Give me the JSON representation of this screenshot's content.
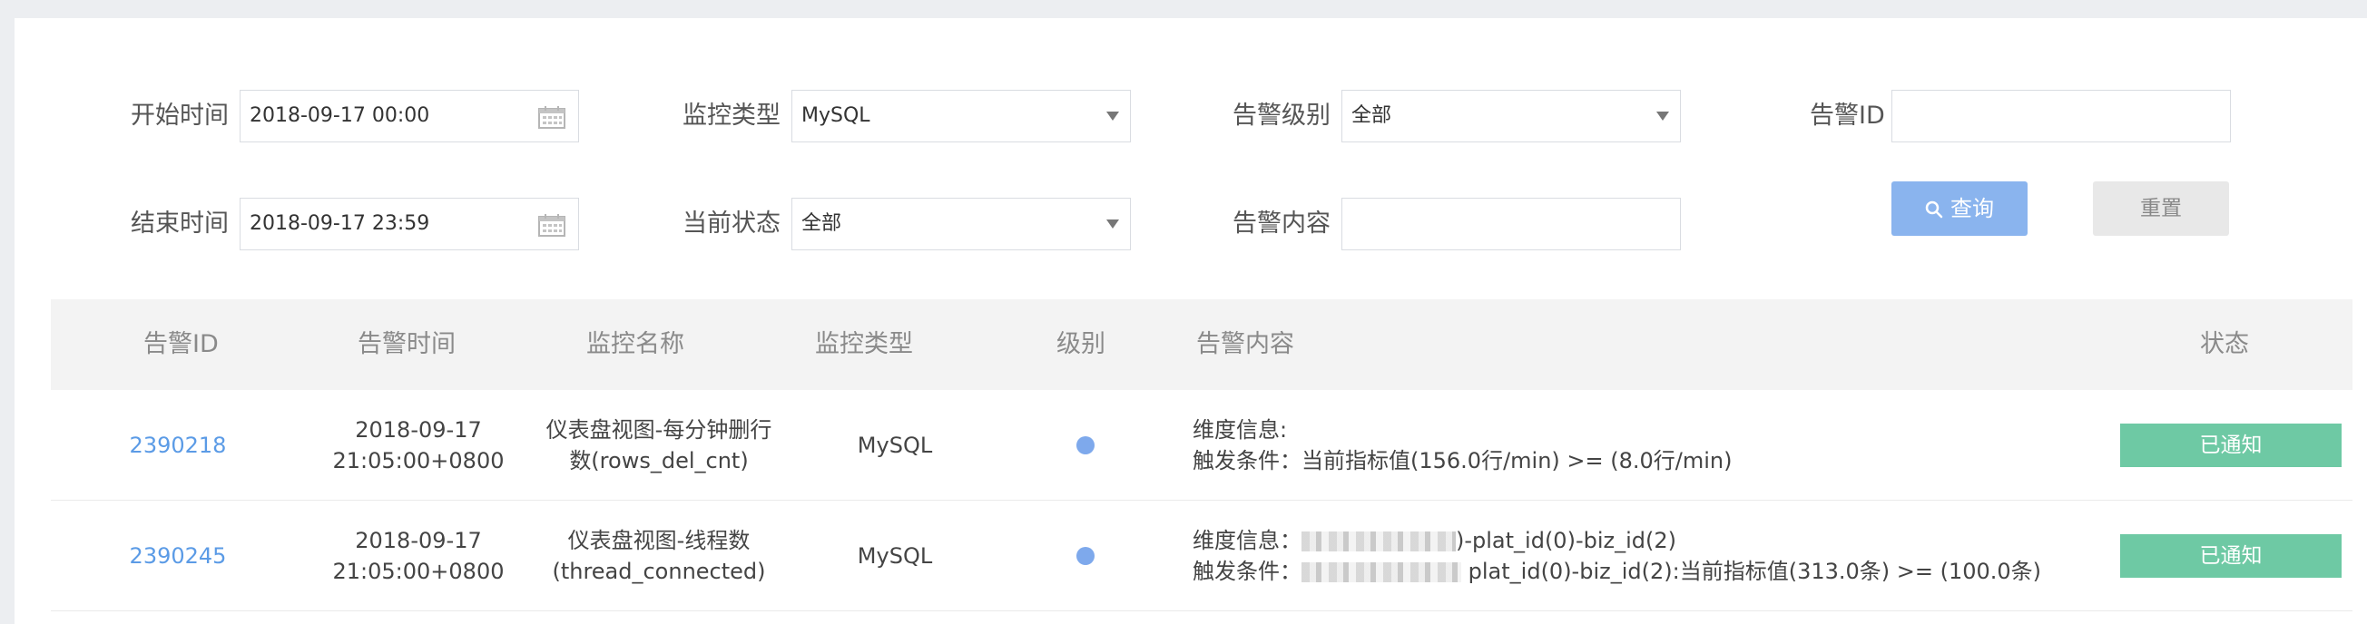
{
  "filters": {
    "start_time_label": "开始时间",
    "start_time_value": "2018-09-17 00:00",
    "end_time_label": "结束时间",
    "end_time_value": "2018-09-17 23:59",
    "monitor_type_label": "监控类型",
    "monitor_type_value": "MySQL",
    "current_status_label": "当前状态",
    "current_status_value": "全部",
    "alert_level_label": "告警级别",
    "alert_level_value": "全部",
    "alert_content_label": "告警内容",
    "alert_content_value": "",
    "alert_id_label": "告警ID",
    "alert_id_value": ""
  },
  "buttons": {
    "query_label": "查询",
    "reset_label": "重置"
  },
  "table": {
    "headers": {
      "alert_id": "告警ID",
      "alert_time": "告警时间",
      "monitor_name": "监控名称",
      "monitor_type": "监控类型",
      "level": "级别",
      "alert_content": "告警内容",
      "status": "状态"
    },
    "rows": [
      {
        "id": "2390218",
        "time_date": "2018-09-17",
        "time_clock": "21:05:00+0800",
        "name_line1": "仪表盘视图-每分钟删行",
        "name_line2": "数(rows_del_cnt)",
        "type": "MySQL",
        "content_dim_label": "维度信息:",
        "content_dim_value": "",
        "content_trigger": "触发条件：当前指标值(156.0行/min) >= (8.0行/min)",
        "status": "已通知"
      },
      {
        "id": "2390245",
        "time_date": "2018-09-17",
        "time_clock": "21:05:00+0800",
        "name_line1": "仪表盘视图-线程数",
        "name_line2": "(thread_connected)",
        "type": "MySQL",
        "content_dim_label": "维度信息：",
        "content_dim_value": ")-plat_id(0)-biz_id(2)",
        "content_trigger_label": "触发条件：",
        "content_trigger_value": "plat_id(0)-biz_id(2):当前指标值(313.0条) >= (100.0条)",
        "status": "已通知"
      }
    ]
  },
  "colors": {
    "link": "#5b9be6",
    "level_dot": "#7ea9ec",
    "status_badge": "#6ec9a4",
    "query_button": "#8ab4ee"
  }
}
